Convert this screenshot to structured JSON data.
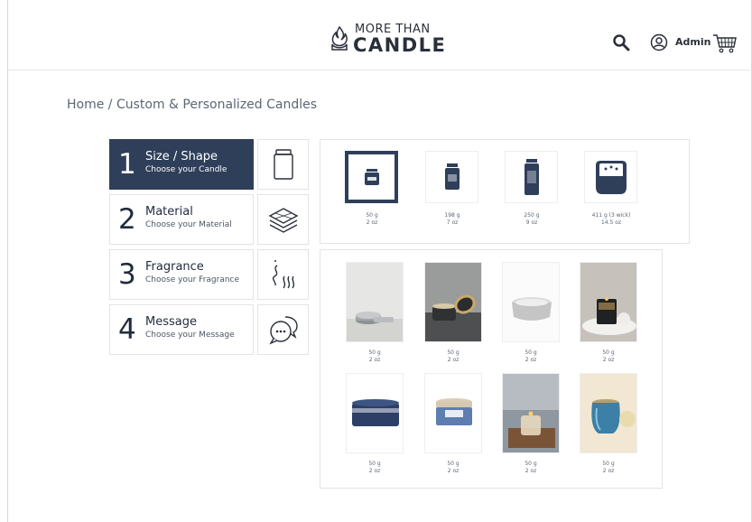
{
  "brand": {
    "line1": "MORE THAN",
    "line2": "CANDLE"
  },
  "header": {
    "user_label": "Admin"
  },
  "breadcrumb": "Home / Custom & Personalized Candles",
  "steps": [
    {
      "num": "1",
      "title": "Size / Shape",
      "sub": "Choose your Candle",
      "icon": "jar-icon",
      "active": true
    },
    {
      "num": "2",
      "title": "Material",
      "sub": "Choose your Material",
      "icon": "layers-icon",
      "active": false
    },
    {
      "num": "3",
      "title": "Fragrance",
      "sub": "Choose your Fragrance",
      "icon": "scent-waves-icon",
      "active": false
    },
    {
      "num": "4",
      "title": "Message",
      "sub": "Choose your Message",
      "icon": "chat-bubbles-icon",
      "active": false
    }
  ],
  "sizes": [
    {
      "weight": "50 g",
      "oz": "2 oz",
      "selected": true
    },
    {
      "weight": "198 g",
      "oz": "7 oz",
      "selected": false
    },
    {
      "weight": "250 g",
      "oz": "9 oz",
      "selected": false
    },
    {
      "weight": "411 g (3 wick)",
      "oz": "14.5 oz",
      "selected": false
    }
  ],
  "products": [
    {
      "weight": "50 g",
      "oz": "2 oz"
    },
    {
      "weight": "50 g",
      "oz": "2 oz"
    },
    {
      "weight": "50 g",
      "oz": "2 oz"
    },
    {
      "weight": "50 g",
      "oz": "2 oz"
    },
    {
      "weight": "50 g",
      "oz": "2 oz"
    },
    {
      "weight": "50 g",
      "oz": "2 oz"
    },
    {
      "weight": "50 g",
      "oz": "2 oz"
    },
    {
      "weight": "50 g",
      "oz": "2 oz"
    }
  ],
  "colors": {
    "accent": "#2f3f5a",
    "border": "#e3e3e3"
  }
}
